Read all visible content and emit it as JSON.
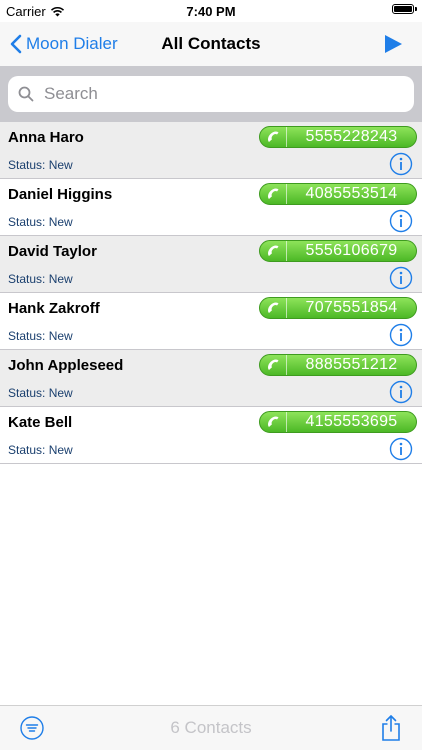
{
  "status_bar": {
    "carrier": "Carrier",
    "time": "7:40 PM",
    "wifi_icon": "wifi-icon",
    "battery_icon": "battery-icon",
    "battery_level": 1.0
  },
  "nav": {
    "back_label": "Moon Dialer",
    "title": "All Contacts",
    "play_icon": "play-icon"
  },
  "search": {
    "placeholder": "Search",
    "value": ""
  },
  "contacts": [
    {
      "name": "Anna Haro",
      "phone": "5555228243",
      "status": "Status: New"
    },
    {
      "name": "Daniel Higgins",
      "phone": "4085553514",
      "status": "Status: New"
    },
    {
      "name": "David Taylor",
      "phone": "5556106679",
      "status": "Status: New"
    },
    {
      "name": "Hank Zakroff",
      "phone": "7075551854",
      "status": "Status: New"
    },
    {
      "name": "John Appleseed",
      "phone": "8885551212",
      "status": "Status: New"
    },
    {
      "name": "Kate Bell",
      "phone": "4155553695",
      "status": "Status: New"
    }
  ],
  "toolbar": {
    "count_label": "6 Contacts",
    "filter_icon": "filter-icon",
    "share_icon": "share-icon"
  },
  "colors": {
    "accent": "#1f7ee8",
    "call_green": "#4cb826",
    "row_shade": "#ededed",
    "search_bg": "#c9c9ce"
  }
}
